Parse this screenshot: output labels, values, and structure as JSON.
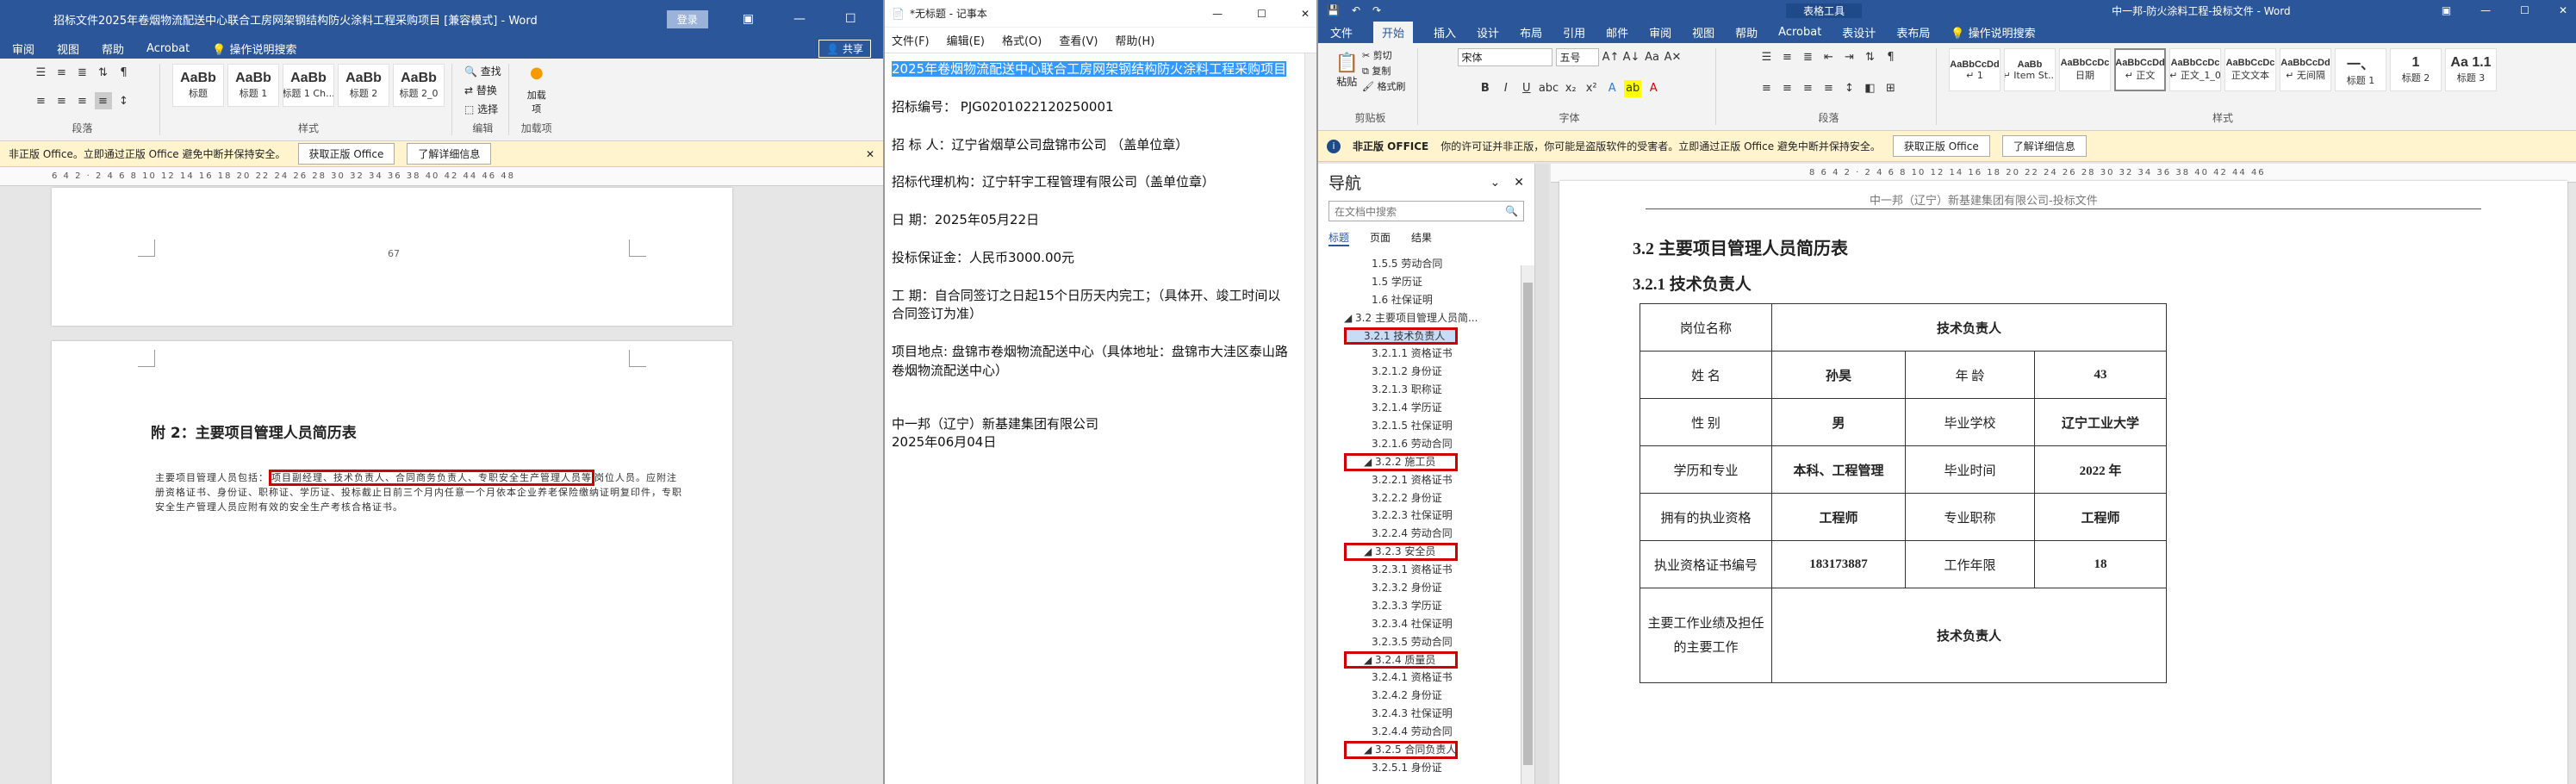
{
  "left": {
    "title": "招标文件2025年卷烟物流配送中心联合工房网架钢结构防火涂料工程采购项目 [兼容模式] - Word",
    "login": "登录",
    "tabs": [
      "审阅",
      "视图",
      "帮助",
      "Acrobat",
      "操作说明搜索"
    ],
    "share": "共享",
    "styles": [
      {
        "sample": "AaBb",
        "name": "标题"
      },
      {
        "sample": "AaBb",
        "name": "标题 1"
      },
      {
        "sample": "AaBb",
        "name": "标题 1 Ch..."
      },
      {
        "sample": "AaBb",
        "name": "标题 2"
      },
      {
        "sample": "AaBb",
        "name": "标题 2_0"
      }
    ],
    "group_labels": {
      "paragraph": "段落",
      "styles": "样式",
      "edit": "编辑",
      "addin": "加载项"
    },
    "edit_items": [
      "查找",
      "替换",
      "选择"
    ],
    "addin": "加载项",
    "msg": "非正版 Office。立即通过正版 Office 避免中断并保持安全。",
    "msg_btn1": "获取正版 Office",
    "msg_btn2": "了解详细信息",
    "ruler": "6  4  2  ·  2  4  6  8  10  12  14  16  18  20  22  24  26  28  30  32  34  36  38  40  42  44  46  48",
    "page_number": "67",
    "heading": "附 2：主要项目管理人员简历表",
    "body_pre": "主要项目管理人员包括：",
    "body_boxed": "项目副经理、技术负责人、合同商务负责人、专职安全生产管理人员等",
    "body_post": "岗位人员。应附注册资格证书、身份证、职称证、学历证、投标截止日前三个月内任意一个月依本企业养老保险缴纳证明复印件，专职安全生产管理人员应附有效的安全生产考核合格证书。"
  },
  "middle": {
    "title": "*无标题 - 记事本",
    "menu": [
      "文件(F)",
      "编辑(E)",
      "格式(O)",
      "查看(V)",
      "帮助(H)"
    ],
    "selected": "2025年卷烟物流配送中心联合工房网架钢结构防火涂料工程采购项目",
    "lines": [
      "招标编号：  PJG0201022120250001",
      "招  标  人：辽宁省烟草公司盘锦市公司 （盖单位章）",
      "招标代理机构：辽宁轩宇工程管理有限公司（盖单位章）",
      "日        期：2025年05月22日",
      "投标保证金：人民币3000.00元",
      "工    期：自合同签订之日起15个日历天内完工；（具体开、竣工时间以合同签订为准）",
      "项目地点: 盘锦市卷烟物流配送中心（具体地址：盘锦市大洼区泰山路卷烟物流配送中心）"
    ],
    "signature_company": "中一邦（辽宁）新基建集团有限公司",
    "signature_date": "2025年06月04日"
  },
  "right": {
    "context_label": "表格工具",
    "title": "中一邦-防火涂料工程-投标文件  -  Word",
    "tabs": [
      "文件",
      "开始",
      "插入",
      "设计",
      "布局",
      "引用",
      "邮件",
      "审阅",
      "视图",
      "帮助",
      "Acrobat",
      "表设计",
      "表布局",
      "操作说明搜索"
    ],
    "clipboard": {
      "paste": "粘贴",
      "cut": "剪切",
      "copy": "复制",
      "format": "格式刷",
      "label": "剪贴板"
    },
    "font_name": "宋体",
    "font_size": "五号",
    "font_label": "字体",
    "para_label": "段落",
    "styles_label": "样式",
    "styles": [
      {
        "sample": "AaBbCcDd",
        "name": "↵ 1"
      },
      {
        "sample": "AaBb",
        "name": "↵ Item St..."
      },
      {
        "sample": "AaBbCcDc",
        "name": "日期"
      },
      {
        "sample": "AaBbCcDd",
        "name": "↵ 正文"
      },
      {
        "sample": "AaBbCcDc",
        "name": "↵ 正文_1_0"
      },
      {
        "sample": "AaBbCcDc",
        "name": "正文文本"
      },
      {
        "sample": "AaBbCcDd",
        "name": "↵ 无间隔"
      },
      {
        "sample": "一、",
        "name": "标题 1"
      },
      {
        "sample": "1",
        "name": "标题 2"
      },
      {
        "sample": "Aa  1.1",
        "name": "标题 3"
      }
    ],
    "msg_title": "非正版 OFFICE",
    "msg": "你的许可证并非正版，你可能是盗版软件的受害者。立即通过正版 Office 避免中断并保持安全。",
    "msg_btn1": "获取正版 Office",
    "msg_btn2": "了解详细信息",
    "nav": {
      "title": "导航",
      "search_placeholder": "在文档中搜索",
      "tabs": [
        "标题",
        "页面",
        "结果"
      ],
      "items": [
        {
          "text": "1.5.5 劳动合同",
          "level": 3,
          "boxed": false
        },
        {
          "text": "1.5 学历证",
          "level": 3,
          "boxed": false
        },
        {
          "text": "1.6 社保证明",
          "level": 3,
          "boxed": false
        },
        {
          "text": "◢ 3.2 主要项目管理人员简...",
          "level": 1,
          "boxed": false
        },
        {
          "text": "3.2.1 技术负责人",
          "level": 2,
          "boxed": true,
          "selected": true
        },
        {
          "text": "3.2.1.1 资格证书",
          "level": 3,
          "boxed": false
        },
        {
          "text": "3.2.1.2 身份证",
          "level": 3,
          "boxed": false
        },
        {
          "text": "3.2.1.3 职称证",
          "level": 3,
          "boxed": false
        },
        {
          "text": "3.2.1.4 学历证",
          "level": 3,
          "boxed": false
        },
        {
          "text": "3.2.1.5 社保证明",
          "level": 3,
          "boxed": false
        },
        {
          "text": "3.2.1.6 劳动合同",
          "level": 3,
          "boxed": false
        },
        {
          "text": "◢ 3.2.2 施工员",
          "level": 2,
          "boxed": true
        },
        {
          "text": "3.2.2.1 资格证书",
          "level": 3,
          "boxed": false
        },
        {
          "text": "3.2.2.2 身份证",
          "level": 3,
          "boxed": false
        },
        {
          "text": "3.2.2.3 社保证明",
          "level": 3,
          "boxed": false
        },
        {
          "text": "3.2.2.4 劳动合同",
          "level": 3,
          "boxed": false
        },
        {
          "text": "◢ 3.2.3 安全员",
          "level": 2,
          "boxed": true
        },
        {
          "text": "3.2.3.1 资格证书",
          "level": 3,
          "boxed": false
        },
        {
          "text": "3.2.3.2 身份证",
          "level": 3,
          "boxed": false
        },
        {
          "text": "3.2.3.3 学历证",
          "level": 3,
          "boxed": false
        },
        {
          "text": "3.2.3.4 社保证明",
          "level": 3,
          "boxed": false
        },
        {
          "text": "3.2.3.5 劳动合同",
          "level": 3,
          "boxed": false
        },
        {
          "text": "◢ 3.2.4 质量员",
          "level": 2,
          "boxed": true
        },
        {
          "text": "3.2.4.1 资格证书",
          "level": 3,
          "boxed": false
        },
        {
          "text": "3.2.4.2 身份证",
          "level": 3,
          "boxed": false
        },
        {
          "text": "3.2.4.3 社保证明",
          "level": 3,
          "boxed": false
        },
        {
          "text": "3.2.4.4 劳动合同",
          "level": 3,
          "boxed": false
        },
        {
          "text": "◢ 3.2.5 合同负责人",
          "level": 2,
          "boxed": true
        },
        {
          "text": "3.2.5.1 身份证",
          "level": 3,
          "boxed": false
        }
      ]
    },
    "ruler": "8  6  4  2  ·  2  4  6  8  10  12  14  16  18  20  22  24  26  28  30  32  34  36  38  40  42  44  46",
    "header_text": "中一邦（辽宁）新基建集团有限公司-投标文件",
    "heading1": "3.2   主要项目管理人员简历表",
    "heading2": "3.2.1 技术负责人",
    "table": {
      "r1": [
        "岗位名称",
        "技术负责人"
      ],
      "r2": [
        "姓      名",
        "孙昊",
        "年      龄",
        "43"
      ],
      "r3": [
        "性      别",
        "男",
        "毕业学校",
        "辽宁工业大学"
      ],
      "r4": [
        "学历和专业",
        "本科、工程管理",
        "毕业时间",
        "2022 年"
      ],
      "r5": [
        "拥有的执业资格",
        "工程师",
        "专业职称",
        "工程师"
      ],
      "r6": [
        "执业资格证书编号",
        "183173887",
        "工作年限",
        "18"
      ],
      "r7": [
        "主要工作业绩及担任的主要工作",
        "技术负责人"
      ]
    }
  }
}
